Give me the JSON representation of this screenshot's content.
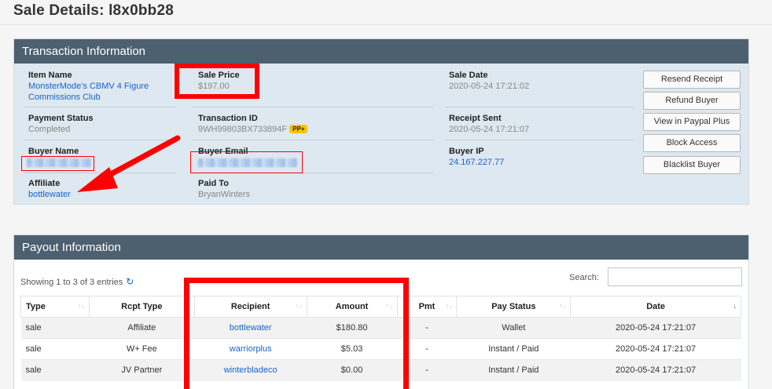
{
  "page": {
    "title": "Sale Details: l8x0bb28"
  },
  "transaction": {
    "heading": "Transaction Information",
    "item_name": {
      "label": "Item Name",
      "value_line1": "MonsterMode's CBMV 4 Figure",
      "value_line2": "Commissions Club"
    },
    "sale_price": {
      "label": "Sale Price",
      "value": "$197.00"
    },
    "sale_date": {
      "label": "Sale Date",
      "value": "2020-05-24 17:21:02"
    },
    "payment_status": {
      "label": "Payment Status",
      "value": "Completed"
    },
    "transaction_id": {
      "label": "Transaction ID",
      "value": "9WH99803BX733894F",
      "badge": "PP+"
    },
    "receipt_sent": {
      "label": "Receipt Sent",
      "value": "2020-05-24 17:21:07"
    },
    "buyer_name": {
      "label": "Buyer Name"
    },
    "buyer_email": {
      "label": "Buyer Email"
    },
    "buyer_ip": {
      "label": "Buyer IP",
      "value": "24.167.227.77"
    },
    "affiliate": {
      "label": "Affiliate",
      "value": "bottlewater"
    },
    "paid_to": {
      "label": "Paid To",
      "value": "BryanWinters"
    },
    "buttons": {
      "resend": "Resend Receipt",
      "refund": "Refund Buyer",
      "paypal": "View in Paypal Plus",
      "block": "Block Access",
      "blacklist": "Blacklist Buyer"
    }
  },
  "payout": {
    "heading": "Payout Information",
    "showing": "Showing 1 to 3 of 3 entries",
    "search_label": "Search:",
    "search_value": "",
    "columns": [
      "Type",
      "Rcpt Type",
      "Recipient",
      "Amount",
      "Pmt",
      "Pay Status",
      "Date"
    ],
    "rows": [
      {
        "type": "sale",
        "rcpt_type": "Affiliate",
        "recipient": "bottlewater",
        "amount": "$180.80",
        "pmt": "-",
        "pay_status": "Wallet",
        "date": "2020-05-24 17:21:07"
      },
      {
        "type": "sale",
        "rcpt_type": "W+ Fee",
        "recipient": "warriorplus",
        "amount": "$5.03",
        "pmt": "-",
        "pay_status": "Instant / Paid",
        "date": "2020-05-24 17:21:07"
      },
      {
        "type": "sale",
        "rcpt_type": "JV Partner",
        "recipient": "winterbladeco",
        "amount": "$0.00",
        "pmt": "-",
        "pay_status": "Instant / Paid",
        "date": "2020-05-24 17:21:07"
      }
    ]
  },
  "icons": {
    "refresh": "refresh-icon",
    "sort": "sort-arrows-icon"
  },
  "colors": {
    "header": "#4d6070",
    "panel_body": "#dde8f0",
    "link": "#1a63c8",
    "annotation": "#ff0000",
    "badge": "#ffc107"
  }
}
